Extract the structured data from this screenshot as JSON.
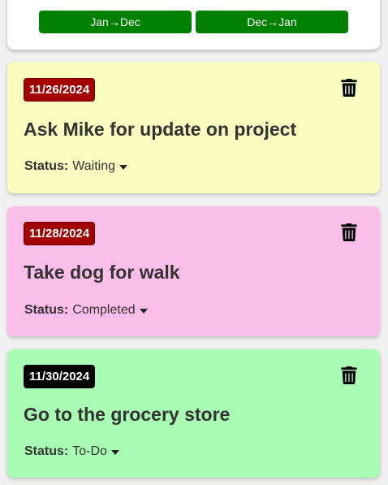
{
  "sort": {
    "asc_label": "Jan→Dec",
    "desc_label": "Dec→Jan",
    "button_color": "#008000"
  },
  "tasks": [
    {
      "date": "11/26/2024",
      "title": "Ask Mike for update on project",
      "status_label": "Status:",
      "status": "Waiting",
      "card_color": "#fafcc0",
      "badge_color": "#a30000"
    },
    {
      "date": "11/28/2024",
      "title": "Take dog for walk",
      "status_label": "Status:",
      "status": "Completed",
      "card_color": "#fbbdea",
      "badge_color": "#a30000"
    },
    {
      "date": "11/30/2024",
      "title": "Go to the grocery store",
      "status_label": "Status:",
      "status": "To-Do",
      "card_color": "#a9fcb3",
      "badge_color": "#000000"
    }
  ],
  "icons": {
    "delete": "trash-icon",
    "dropdown": "caret-down-icon"
  }
}
